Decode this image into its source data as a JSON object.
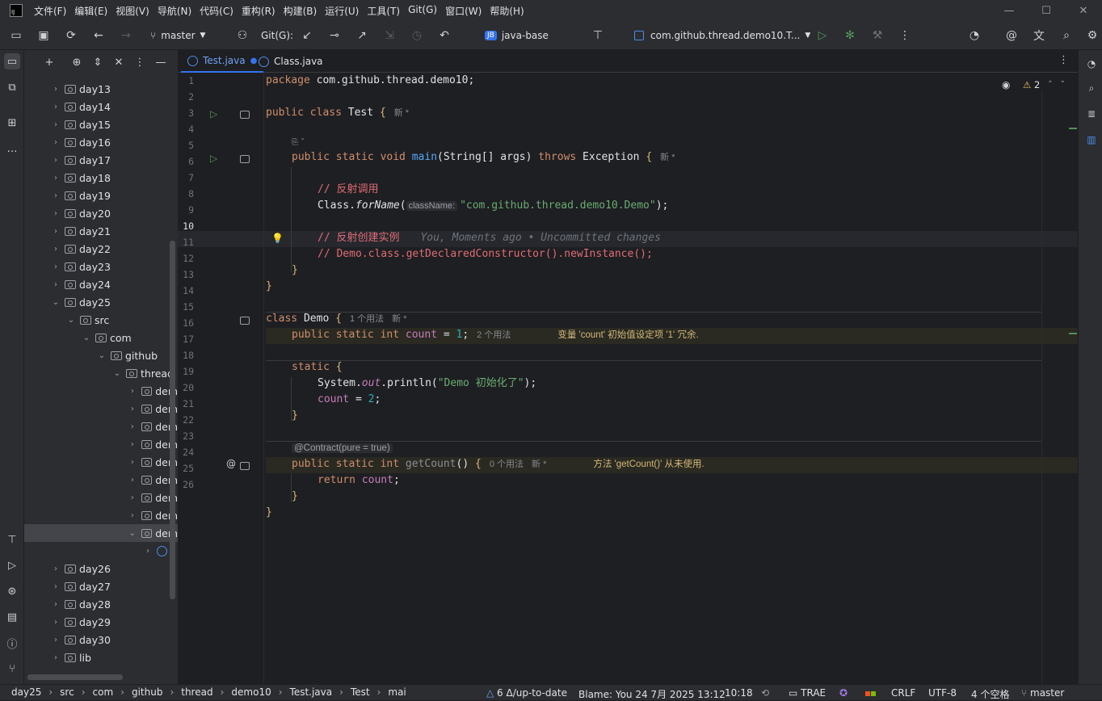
{
  "menu": [
    "文件(F)",
    "编辑(E)",
    "视图(V)",
    "导航(N)",
    "代码(C)",
    "重构(R)",
    "构建(B)",
    "运行(U)",
    "工具(T)",
    "Git(G)",
    "窗口(W)",
    "帮助(H)"
  ],
  "toolbar": {
    "branch": "master",
    "git_label": "Git(G):",
    "project_badge": "JB",
    "project": "java-base",
    "run_config": "com.github.thread.demo10.T..."
  },
  "project_tree": [
    {
      "label": "day13",
      "depth": 0,
      "open": false
    },
    {
      "label": "day14",
      "depth": 0,
      "open": false
    },
    {
      "label": "day15",
      "depth": 0,
      "open": false
    },
    {
      "label": "day16",
      "depth": 0,
      "open": false
    },
    {
      "label": "day17",
      "depth": 0,
      "open": false
    },
    {
      "label": "day18",
      "depth": 0,
      "open": false
    },
    {
      "label": "day19",
      "depth": 0,
      "open": false
    },
    {
      "label": "day20",
      "depth": 0,
      "open": false
    },
    {
      "label": "day21",
      "depth": 0,
      "open": false
    },
    {
      "label": "day22",
      "depth": 0,
      "open": false
    },
    {
      "label": "day23",
      "depth": 0,
      "open": false
    },
    {
      "label": "day24",
      "depth": 0,
      "open": false
    },
    {
      "label": "day25",
      "depth": 0,
      "open": true
    },
    {
      "label": "src",
      "depth": 1,
      "open": true
    },
    {
      "label": "com",
      "depth": 2,
      "open": true
    },
    {
      "label": "github",
      "depth": 3,
      "open": true
    },
    {
      "label": "thread",
      "depth": 4,
      "open": true
    },
    {
      "label": "dem",
      "depth": 5,
      "open": false
    },
    {
      "label": "dem",
      "depth": 5,
      "open": false
    },
    {
      "label": "dem",
      "depth": 5,
      "open": false
    },
    {
      "label": "dem",
      "depth": 5,
      "open": false
    },
    {
      "label": "dem",
      "depth": 5,
      "open": false
    },
    {
      "label": "dem",
      "depth": 5,
      "open": false
    },
    {
      "label": "dem",
      "depth": 5,
      "open": false
    },
    {
      "label": "dem",
      "depth": 5,
      "open": false
    },
    {
      "label": "dem",
      "depth": 5,
      "open": true
    },
    {
      "label": "",
      "depth": 6,
      "open": false
    },
    {
      "label": "day26",
      "depth": 0,
      "open": false
    },
    {
      "label": "day27",
      "depth": 0,
      "open": false
    },
    {
      "label": "day28",
      "depth": 0,
      "open": false
    },
    {
      "label": "day29",
      "depth": 0,
      "open": false
    },
    {
      "label": "day30",
      "depth": 0,
      "open": false
    },
    {
      "label": "lib",
      "depth": 0,
      "open": false
    }
  ],
  "tabs": [
    {
      "label": "Test.java",
      "active": true,
      "modified": true
    },
    {
      "label": "Class.java",
      "active": false,
      "modified": false
    }
  ],
  "editor": {
    "warnings_count": "2",
    "line_numbers": [
      "1",
      "2",
      "3",
      "4",
      "5",
      "6",
      "7",
      "8",
      "9",
      "10",
      "11",
      "12",
      "13",
      "14",
      "15",
      "16",
      "17",
      "18",
      "19",
      "20",
      "21",
      "22",
      "23",
      "24",
      "25",
      "26"
    ],
    "hints": {
      "new_star": "新 *",
      "usages_1": "1 个用法",
      "usages_2": "2 个用法",
      "usages_0": "0 个用法",
      "class_name_param": "className:",
      "contract": "@Contract(pure = true)",
      "blame_inline": "You, Moments ago • Uncommitted changes",
      "warn_count": "变量 'count' 初始值设定项 '1' 冗余.",
      "warn_getcount": "方法 'getCount()' 从未使用."
    },
    "code": {
      "l1_kw": "package",
      "l1_rest": " com.github.thread.demo10;",
      "l3_kw": "public class",
      "l3_name": " Test ",
      "l3_brace": "{",
      "l5_kw": "public static void",
      "l5_fn": " main",
      "l5_sig": "(String[] args) ",
      "l5_throws": "throws",
      "l5_exc": " Exception ",
      "l5_brace": "{",
      "l7_comment": "// 反射调用",
      "l8_cls": "Class.",
      "l8_fn": "forName",
      "l8_paren": "(",
      "l8_str": "\"com.github.thread.demo10.Demo\"",
      "l8_end": ");",
      "l10_comment": "// 反射创建实例",
      "l11_comment": "// Demo.class.getDeclaredConstructor().newInstance();",
      "brace_close": "}",
      "l15_kw": "class",
      "l15_name": " Demo ",
      "l15_brace": "{",
      "l16_kw": "public static int",
      "l16_fld": " count",
      "l16_eq": " = ",
      "l16_num": "1",
      "l16_end": ";",
      "l18_kw": "static",
      "l18_brace": " {",
      "l19_a": "System.",
      "l19_fld": "out",
      "l19_b": ".println(",
      "l19_str": "\"Demo 初始化了\"",
      "l19_end": ");",
      "l20_fld": "count",
      "l20_eq": " = ",
      "l20_num": "2",
      "l20_end": ";",
      "l23_kw": "public static int",
      "l23_fn": " getCount",
      "l23_sig": "() ",
      "l23_brace": "{",
      "l24_kw": "return",
      "l24_fld": " count",
      "l24_end": ";"
    }
  },
  "statusbar": {
    "breadcrumbs": [
      "day25",
      "src",
      "com",
      "github",
      "thread",
      "demo10",
      "Test.java",
      "Test",
      "mai"
    ],
    "vcs_status": "6 Δ/up-to-date",
    "blame": "Blame: You 24 7月 2025 13:12",
    "position": "10:18",
    "trae": "TRAE",
    "line_sep": "CRLF",
    "encoding": "UTF-8",
    "indent": "4 个空格",
    "branch": "master"
  },
  "colors": {
    "accent": "#3574f0",
    "keyword": "#cf8e6d",
    "string": "#6aab73",
    "function": "#56a8f5",
    "comment": "#e06c75",
    "number": "#2aacb8",
    "field": "#c77dbb",
    "warning": "#d5b778"
  }
}
